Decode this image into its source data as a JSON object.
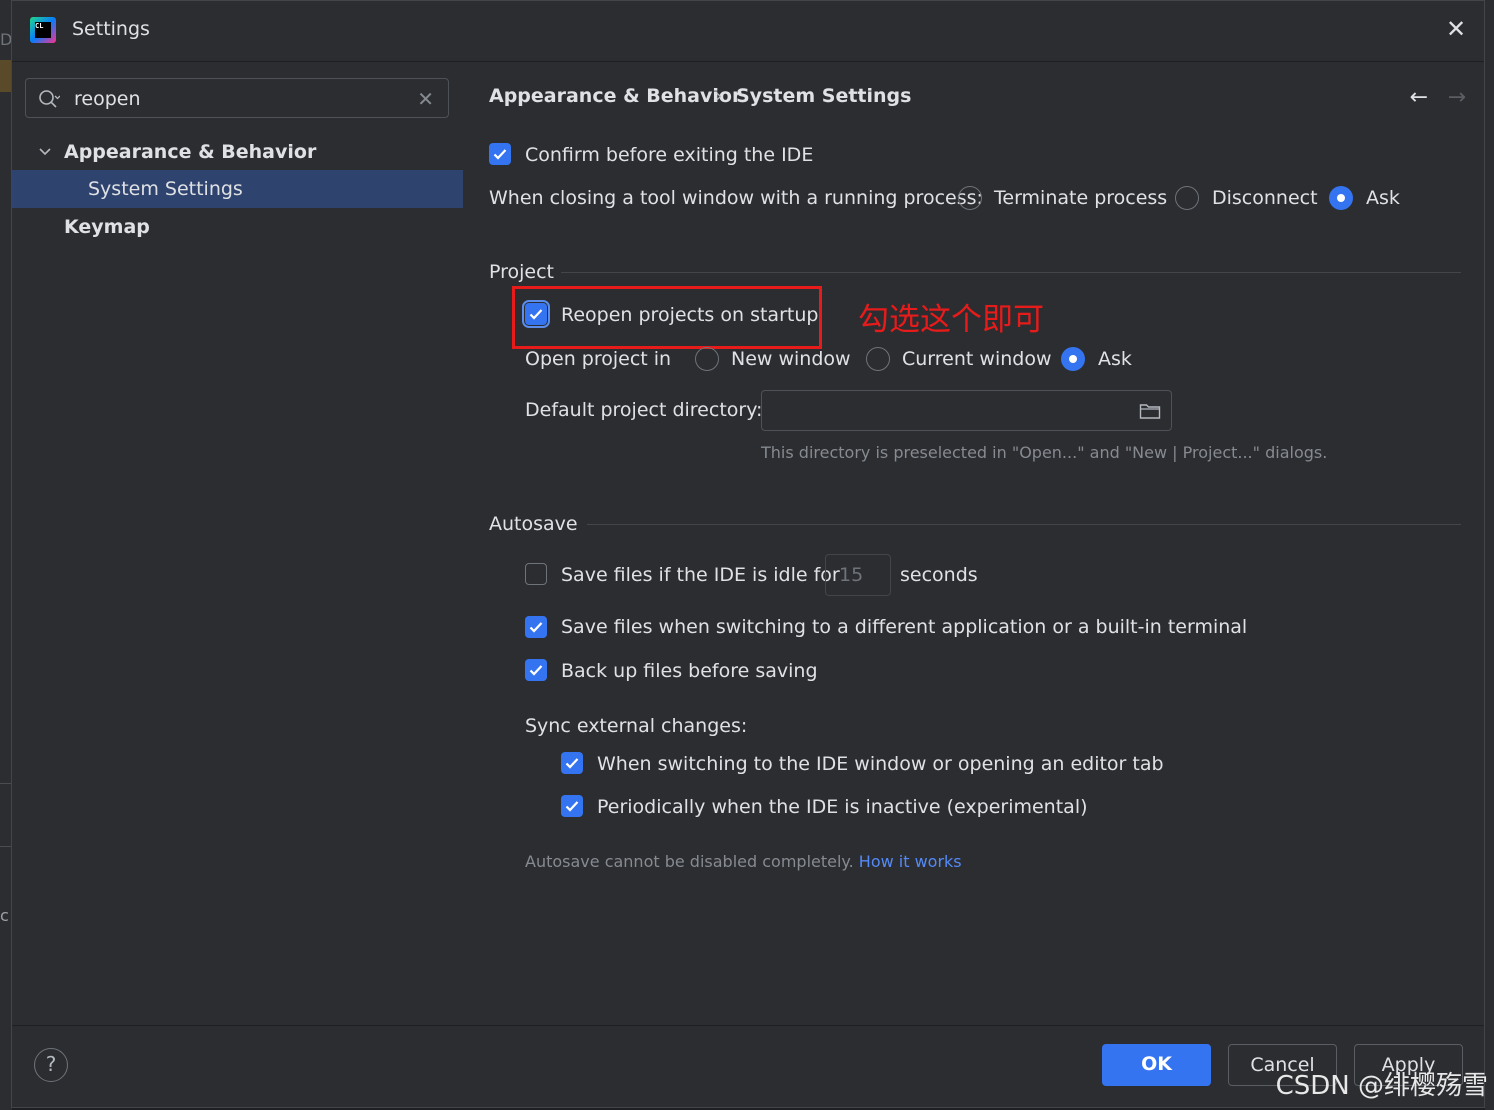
{
  "window": {
    "title": "Settings",
    "app_icon": "clion-logo-icon",
    "app_icon_text": "CL"
  },
  "search": {
    "value": "reopen"
  },
  "sidebar": {
    "items": [
      {
        "label": "Appearance & Behavior"
      },
      {
        "label": "System Settings"
      },
      {
        "label": "Keymap"
      }
    ]
  },
  "breadcrumb": {
    "parent": "Appearance & Behavior",
    "separator": "›",
    "current": "System Settings"
  },
  "general": {
    "confirm_exit": "Confirm before exiting the IDE",
    "closing_label": "When closing a tool window with a running process:",
    "opt_terminate": "Terminate process",
    "opt_disconnect": "Disconnect",
    "opt_ask": "Ask",
    "selected": "Ask"
  },
  "project": {
    "section": "Project",
    "reopen": "Reopen projects on startup",
    "open_in_label": "Open project in",
    "opt_new_window": "New window",
    "opt_current_window": "Current window",
    "opt_ask": "Ask",
    "selected": "Ask",
    "default_dir_label": "Default project directory:",
    "default_dir_value": "",
    "default_dir_hint": "This directory is preselected in \"Open...\" and \"New | Project...\" dialogs."
  },
  "annotation": {
    "text": "勾选这个即可",
    "color": "#e81b1b"
  },
  "autosave": {
    "section": "Autosave",
    "idle_label": "Save files if the IDE is idle for",
    "idle_value": "15",
    "idle_unit": "seconds",
    "switching": "Save files when switching to a different application or a built-in terminal",
    "backup": "Back up files before saving",
    "sync_label": "Sync external changes:",
    "sync_switch": "When switching to the IDE window or opening an editor tab",
    "sync_periodic": "Periodically when the IDE is inactive (experimental)",
    "note": "Autosave cannot be disabled completely.",
    "note_link": "How it works"
  },
  "footer": {
    "ok": "OK",
    "cancel": "Cancel",
    "apply": "Apply",
    "help": "?"
  },
  "watermark": "CSDN @绯樱殇雪",
  "colors": {
    "accent": "#3574f0",
    "background": "#2b2d30",
    "selection": "#2e436e",
    "link": "#548af7"
  }
}
